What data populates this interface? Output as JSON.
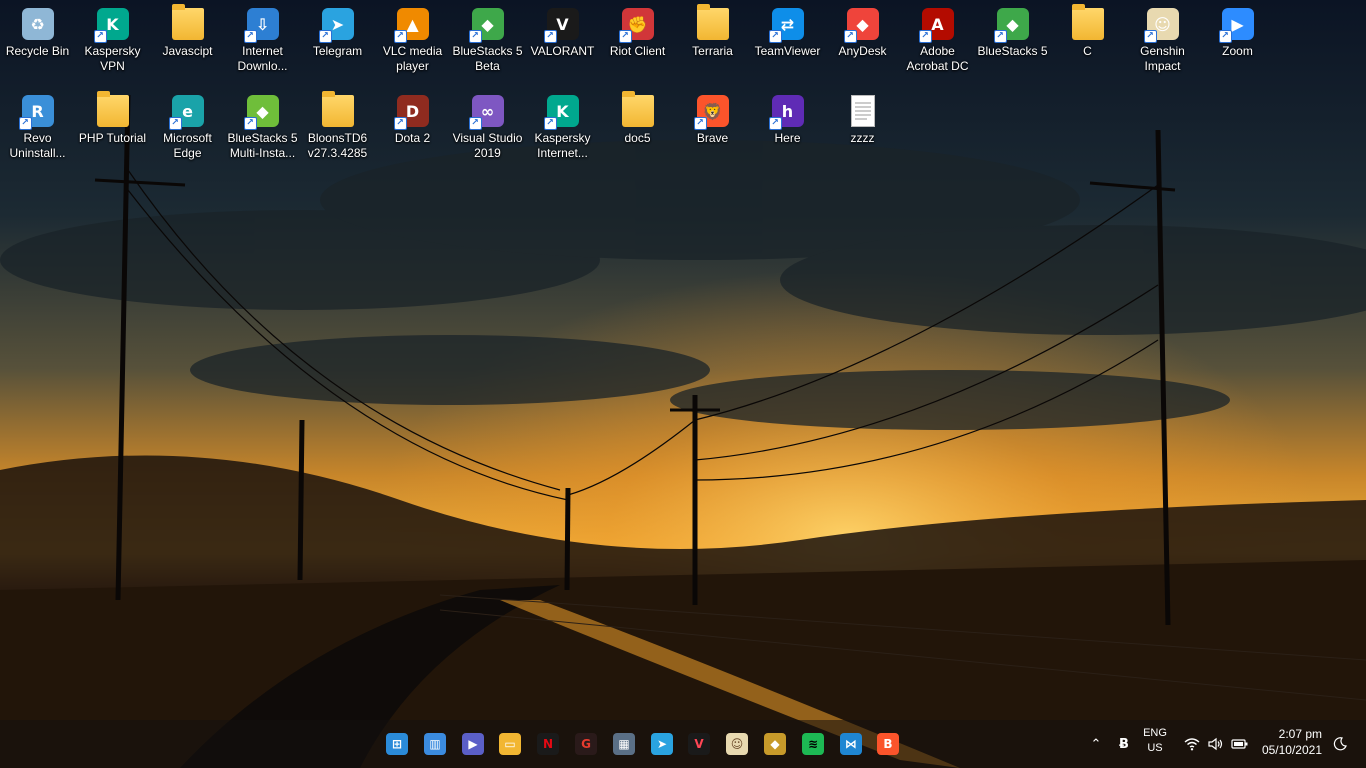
{
  "desktop": {
    "icons": [
      {
        "label": "Recycle Bin",
        "icon": "recycle-bin-icon",
        "color": "#8fb7d6",
        "glyph": "♻",
        "shortcut": false
      },
      {
        "label": "Kaspersky\nVPN",
        "icon": "kaspersky-vpn-icon",
        "color": "#00a88e",
        "glyph": "K",
        "shortcut": true
      },
      {
        "label": "Javascipt",
        "icon": "folder-icon",
        "type": "folder",
        "shortcut": false
      },
      {
        "label": "Internet\nDownlo...",
        "icon": "internet-download-manager-icon",
        "color": "#2d7fd3",
        "glyph": "⇩",
        "shortcut": true
      },
      {
        "label": "Telegram",
        "icon": "telegram-icon",
        "color": "#2aa3e0",
        "glyph": "➤",
        "shortcut": true
      },
      {
        "label": "VLC media\nplayer",
        "icon": "vlc-icon",
        "color": "#f08a00",
        "glyph": "▲",
        "shortcut": true
      },
      {
        "label": "BlueStacks 5\nBeta",
        "icon": "bluestacks-icon",
        "color": "#3ea84a",
        "glyph": "◆",
        "shortcut": true
      },
      {
        "label": "VALORANT",
        "icon": "valorant-icon",
        "color": "#1a1a1a",
        "glyph": "V",
        "shortcut": true
      },
      {
        "label": "Riot Client",
        "icon": "riot-client-icon",
        "color": "#d13639",
        "glyph": "✊",
        "shortcut": true
      },
      {
        "label": "Terraria",
        "icon": "folder-icon",
        "type": "folder",
        "shortcut": false
      },
      {
        "label": "TeamViewer",
        "icon": "teamviewer-icon",
        "color": "#0e8ee9",
        "glyph": "⇄",
        "shortcut": true
      },
      {
        "label": "AnyDesk",
        "icon": "anydesk-icon",
        "color": "#ef443b",
        "glyph": "◆",
        "shortcut": true
      },
      {
        "label": "Adobe\nAcrobat DC",
        "icon": "acrobat-icon",
        "color": "#b30b00",
        "glyph": "A",
        "shortcut": true
      },
      {
        "label": "BlueStacks 5",
        "icon": "bluestacks-icon",
        "color": "#3ea84a",
        "glyph": "◆",
        "shortcut": true
      },
      {
        "label": "C",
        "icon": "folder-icon",
        "type": "folder",
        "shortcut": false
      },
      {
        "label": "Genshin\nImpact",
        "icon": "genshin-impact-icon",
        "color": "#e8d9b0",
        "glyph": "☺",
        "shortcut": true
      },
      {
        "label": "Zoom",
        "icon": "zoom-icon",
        "color": "#2d8cff",
        "glyph": "▶",
        "shortcut": true
      },
      {
        "label": "Revo\nUninstall...",
        "icon": "revo-uninstaller-icon",
        "color": "#3a8fd8",
        "glyph": "R",
        "shortcut": true
      },
      {
        "label": "PHP Tutorial",
        "icon": "folder-icon",
        "type": "folder",
        "shortcut": false
      },
      {
        "label": "Microsoft\nEdge",
        "icon": "edge-icon",
        "color": "#1aa3a9",
        "glyph": "e",
        "shortcut": true
      },
      {
        "label": "BlueStacks 5\nMulti-Insta...",
        "icon": "bluestacks-multi-instance-icon",
        "color": "#6fbe3a",
        "glyph": "◆",
        "shortcut": true
      },
      {
        "label": "BloonsTD6\nv27.3.4285",
        "icon": "folder-icon",
        "type": "folder",
        "shortcut": false
      },
      {
        "label": "Dota 2",
        "icon": "dota2-icon",
        "color": "#8f2b1f",
        "glyph": "D",
        "shortcut": true
      },
      {
        "label": "Visual Studio\n2019",
        "icon": "visual-studio-icon",
        "color": "#7e57c2",
        "glyph": "∞",
        "shortcut": true
      },
      {
        "label": "Kaspersky\nInternet...",
        "icon": "kaspersky-internet-security-icon",
        "color": "#00a88e",
        "glyph": "K",
        "shortcut": true
      },
      {
        "label": "doc5",
        "icon": "folder-icon",
        "type": "folder",
        "shortcut": false
      },
      {
        "label": "Brave",
        "icon": "brave-icon",
        "color": "#fb542b",
        "glyph": "🦁",
        "shortcut": true
      },
      {
        "label": "Here",
        "icon": "here-icon",
        "color": "#5f2bb5",
        "glyph": "h",
        "shortcut": true
      },
      {
        "label": "zzzz",
        "icon": "text-file-icon",
        "type": "doc",
        "shortcut": false
      }
    ]
  },
  "taskbar": {
    "apps": [
      {
        "name": "start-button",
        "icon": "windows-start-icon",
        "color": "#2b8bd9",
        "glyph": "⊞"
      },
      {
        "name": "taskbar-widgets",
        "icon": "widgets-icon",
        "color": "#3b8bdf",
        "glyph": "▥"
      },
      {
        "name": "taskbar-chat",
        "icon": "chat-icon",
        "color": "#5b5fc7",
        "glyph": "▶"
      },
      {
        "name": "taskbar-file-explorer",
        "icon": "file-explorer-icon",
        "color": "#f2b632",
        "glyph": "▭"
      },
      {
        "name": "taskbar-netflix",
        "icon": "netflix-icon",
        "color": "#1a1a1a",
        "glyph": "N",
        "fg": "#e50914"
      },
      {
        "name": "taskbar-garena",
        "icon": "garena-icon",
        "color": "#2a1a1a",
        "glyph": "G",
        "fg": "#e63b2e"
      },
      {
        "name": "taskbar-calculator",
        "icon": "calculator-icon",
        "color": "#5a6f86",
        "glyph": "▦"
      },
      {
        "name": "taskbar-telegram",
        "icon": "telegram-icon",
        "color": "#2aa3e0",
        "glyph": "➤"
      },
      {
        "name": "taskbar-valorant",
        "icon": "valorant-icon",
        "color": "#1a1a1a",
        "glyph": "V",
        "fg": "#ff4655"
      },
      {
        "name": "taskbar-genshin",
        "icon": "genshin-impact-icon",
        "color": "#e8d9b0",
        "glyph": "☺",
        "fg": "#6b4b2a"
      },
      {
        "name": "taskbar-bluestacks",
        "icon": "bluestacks-icon",
        "color": "#c79a2a",
        "glyph": "◆"
      },
      {
        "name": "taskbar-spotify",
        "icon": "spotify-icon",
        "color": "#1db954",
        "glyph": "≋",
        "fg": "#000"
      },
      {
        "name": "taskbar-vscode",
        "icon": "vscode-icon",
        "color": "#1f86d2",
        "glyph": "⋈"
      },
      {
        "name": "taskbar-brave",
        "icon": "brave-icon",
        "color": "#fb542b",
        "glyph": "B"
      }
    ],
    "tray": {
      "chevron_icon": "chevron-up-icon",
      "tray_app_icon": "tray-app-icon",
      "language_primary": "ENG",
      "language_secondary": "US",
      "time": "2:07 pm",
      "date": "05/10/2021"
    }
  }
}
